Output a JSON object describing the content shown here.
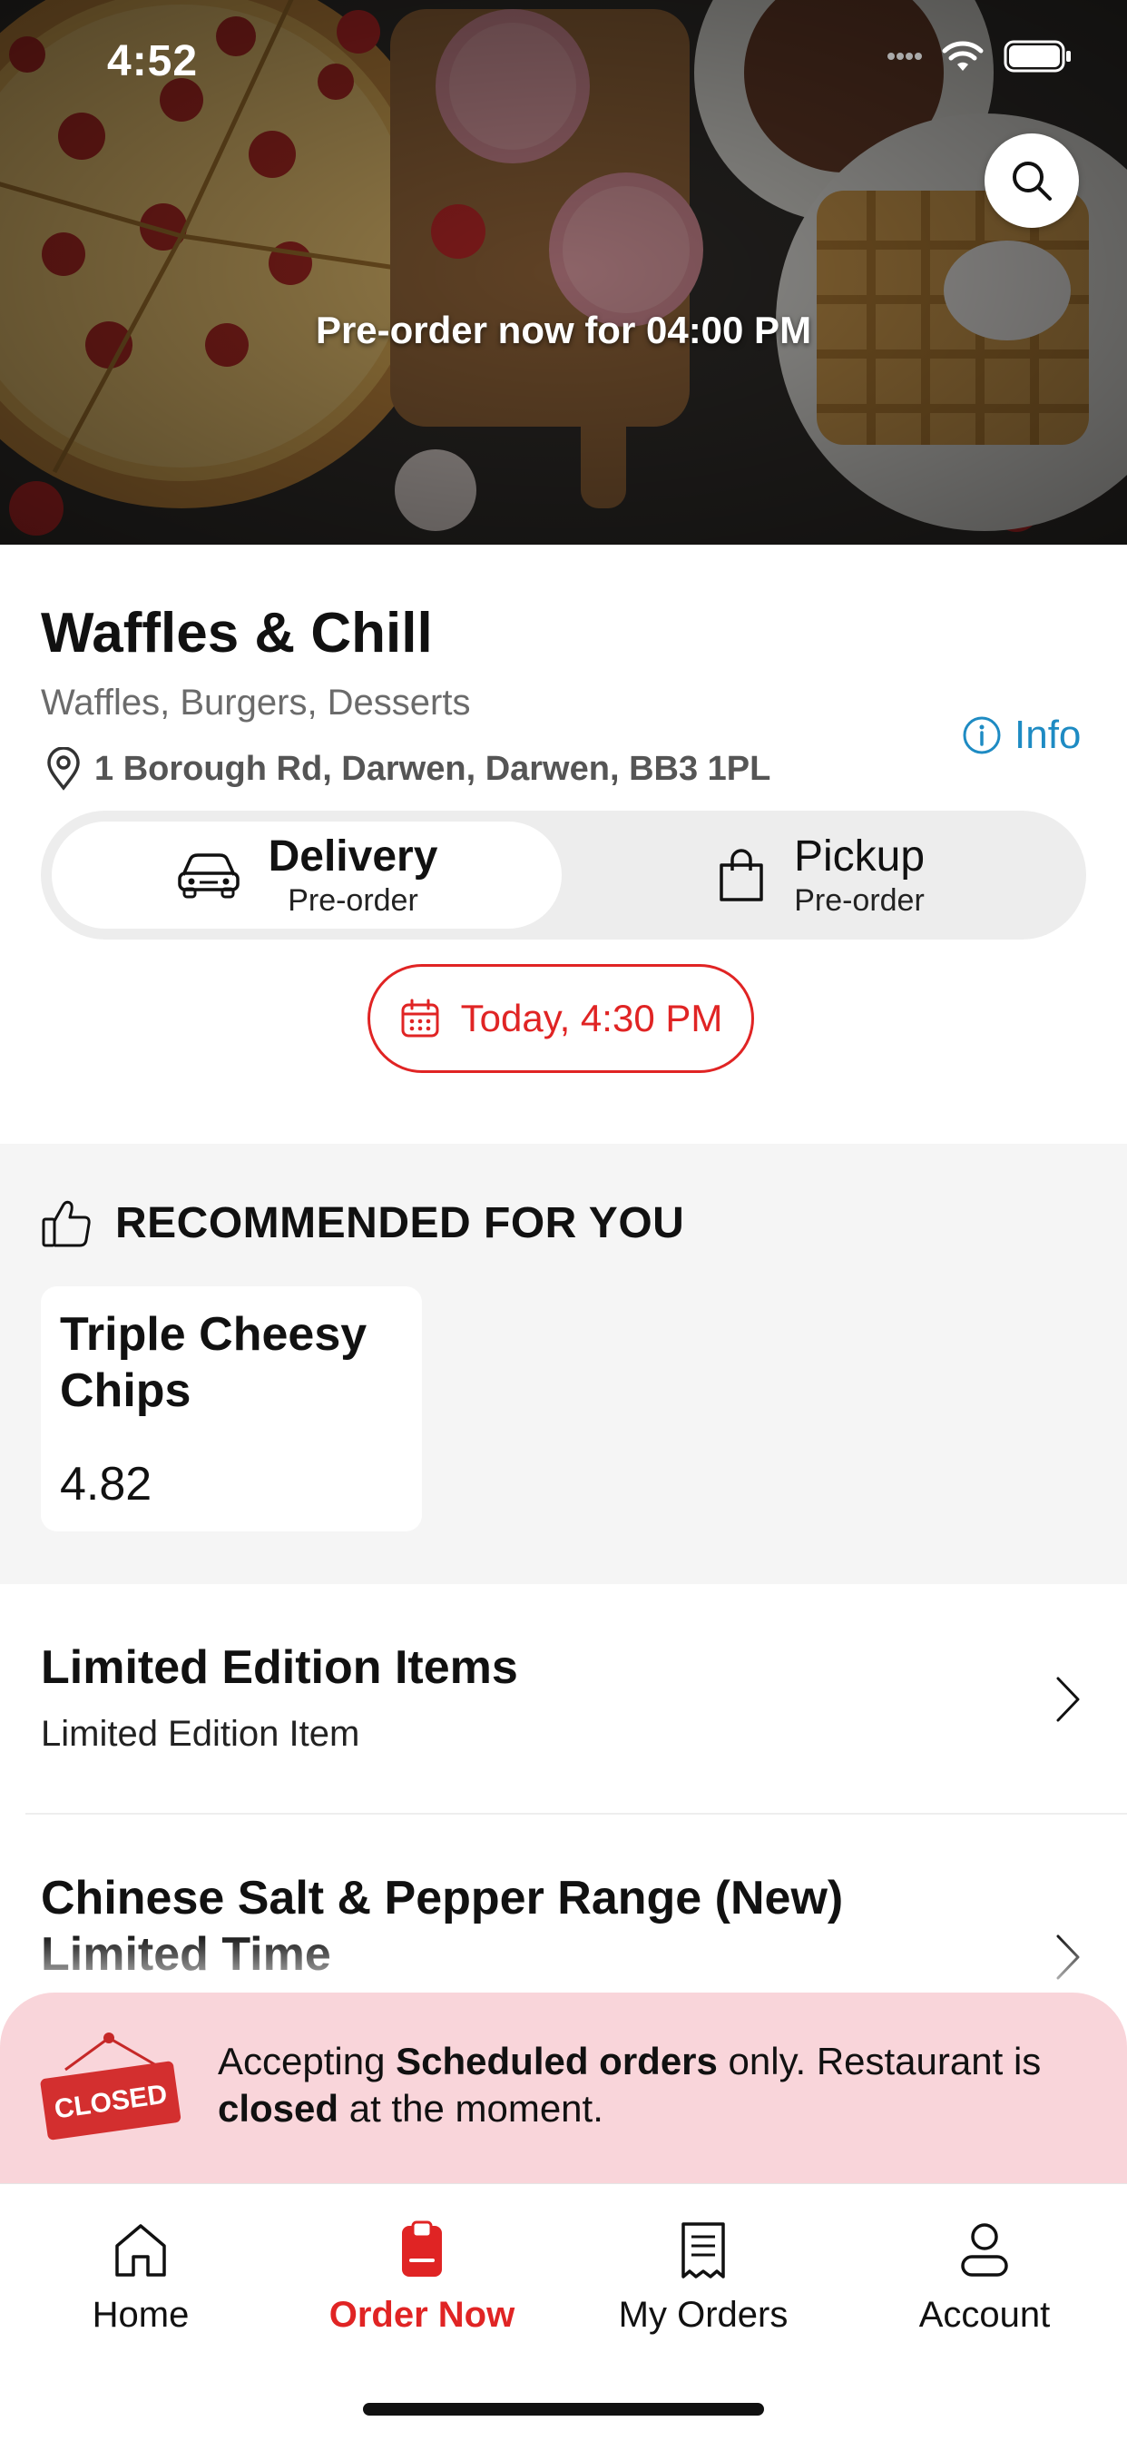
{
  "status_bar": {
    "time": "4:52"
  },
  "hero": {
    "preorder_text": "Pre-order now for 04:00 PM"
  },
  "restaurant": {
    "name": "Waffles & Chill",
    "cuisine": "Waffles, Burgers, Desserts",
    "address": "1 Borough Rd, Darwen, Darwen, BB3 1PL",
    "info_label": "Info"
  },
  "order_mode": {
    "delivery": {
      "label": "Delivery",
      "sub": "Pre-order",
      "selected": true
    },
    "pickup": {
      "label": "Pickup",
      "sub": "Pre-order",
      "selected": false
    }
  },
  "schedule": {
    "label": "Today, 4:30 PM"
  },
  "recommended": {
    "title": "RECOMMENDED FOR YOU",
    "items": [
      {
        "name": "Triple Cheesy Chips",
        "price": "4.82"
      }
    ]
  },
  "categories": [
    {
      "title": "Limited Edition Items",
      "subtitle": "Limited Edition Item"
    },
    {
      "title": "Chinese Salt & Pepper Range (New) Limited Time",
      "subtitle": ""
    }
  ],
  "closed_banner": {
    "sign_text": "CLOSED",
    "text_1": "Accepting ",
    "text_bold_1": "Scheduled orders",
    "text_2": " only. Restaurant is ",
    "text_bold_2": "closed",
    "text_3": " at the moment."
  },
  "tabs": [
    {
      "label": "Home",
      "icon": "home-icon",
      "active": false
    },
    {
      "label": "Order Now",
      "icon": "order-icon",
      "active": true
    },
    {
      "label": "My Orders",
      "icon": "receipt-icon",
      "active": false
    },
    {
      "label": "Account",
      "icon": "person-icon",
      "active": false
    }
  ],
  "colors": {
    "accent": "#e02424",
    "info": "#1e8bc3",
    "banner": "#f9d5da",
    "section_bg": "#f5f5f5"
  }
}
